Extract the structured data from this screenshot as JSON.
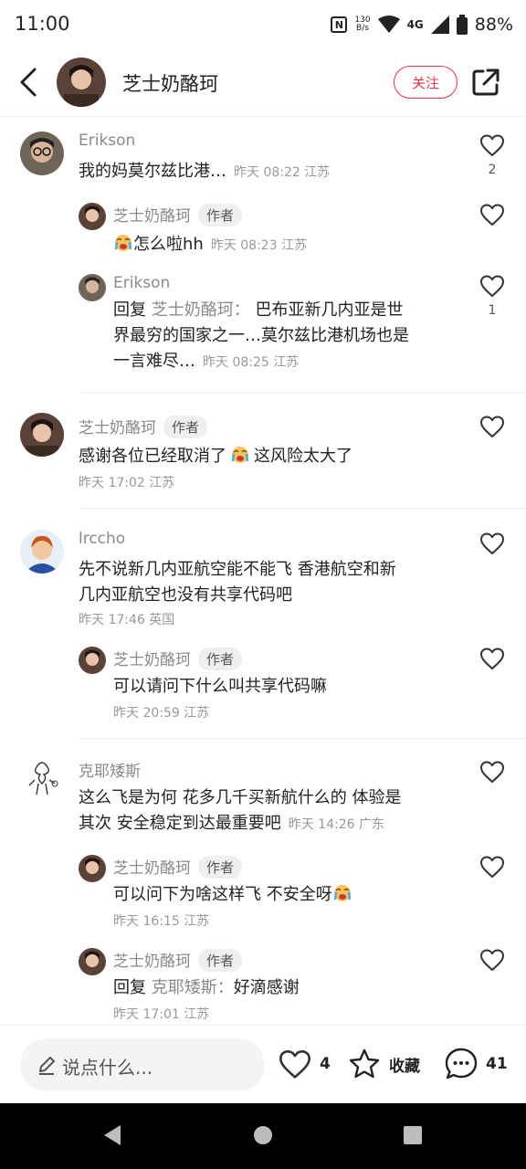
{
  "status_bar": {
    "time": "11:00",
    "speed_value": "130",
    "speed_unit": "B/s",
    "network": "4G",
    "battery": "88%"
  },
  "header": {
    "username": "芝士奶酪珂",
    "follow_label": "关注"
  },
  "comments": [
    {
      "username": "Erikson",
      "text": "我的妈莫尔兹比港…",
      "meta": "昨天 08:22 江苏",
      "likes": "2"
    },
    {
      "username": "芝士奶酪珂",
      "badge": "作者",
      "text": "怎么啦hh",
      "meta": "昨天 08:23 江苏"
    },
    {
      "username": "Erikson",
      "reply_prefix": "回复",
      "reply_to": "芝士奶酪珂：",
      "text_l1": "巴布亚新几内亚是世",
      "text_l2": "界最穷的国家之一…莫尔兹比港机场也是",
      "text_l3": "一言难尽…",
      "meta": "昨天 08:25 江苏",
      "likes": "1"
    },
    {
      "username": "芝士奶酪珂",
      "badge": "作者",
      "text_a": "感谢各位已经取消了",
      "text_b": "这风险太大了",
      "meta": "昨天 17:02 江苏"
    },
    {
      "username": "lrccho",
      "text_l1": "先不说新几内亚航空能不能飞 香港航空和新",
      "text_l2": "几内亚航空也没有共享代码吧",
      "meta": "昨天 17:46 英国"
    },
    {
      "username": "芝士奶酪珂",
      "badge": "作者",
      "text": "可以请问下什么叫共享代码嘛",
      "meta": "昨天 20:59 江苏"
    },
    {
      "username": "克耶矮斯",
      "text_l1": "这么飞是为何 花多几千买新航什么的 体验是",
      "text_l2": "其次 安全稳定到达最重要吧",
      "meta": "昨天 14:26 广东"
    },
    {
      "username": "芝士奶酪珂",
      "badge": "作者",
      "text": "可以问下为啥这样飞 不安全呀",
      "meta": "昨天 16:15 江苏"
    },
    {
      "username": "芝士奶酪珂",
      "badge": "作者",
      "reply_prefix": "回复",
      "reply_to": "克耶矮斯：",
      "text": "好滴感谢",
      "meta": "昨天 17:01 江苏"
    }
  ],
  "bottom_bar": {
    "input_placeholder": "说点什么...",
    "like_count": "4",
    "collect_label": "收藏",
    "comment_count": "41"
  },
  "colors": {
    "accent": "#e8334a",
    "meta_gray": "#999999"
  }
}
